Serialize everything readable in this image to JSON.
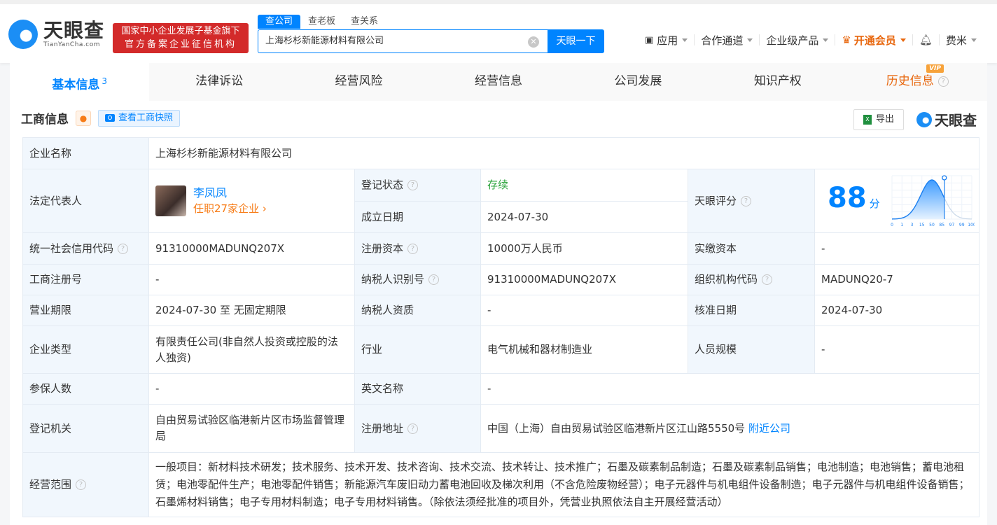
{
  "header": {
    "logo_cn": "天眼查",
    "logo_en": "TianYanCha.com",
    "badge_line1": "国家中小企业发展子基金旗下",
    "badge_line2": "官方备案企业征信机构",
    "search_tabs": [
      "查公司",
      "查老板",
      "查关系"
    ],
    "search_value": "上海杉杉新能源材料有限公司",
    "search_button": "天眼一下",
    "nav": [
      "应用",
      "合作通道",
      "企业级产品",
      "开通会员",
      "费米"
    ]
  },
  "tabs": [
    {
      "label": "基本信息",
      "count": "3"
    },
    {
      "label": "法律诉讼"
    },
    {
      "label": "经营风险"
    },
    {
      "label": "经营信息"
    },
    {
      "label": "公司发展"
    },
    {
      "label": "知识产权"
    },
    {
      "label": "历史信息",
      "badge": "VIP"
    }
  ],
  "section": {
    "title": "工商信息",
    "snapshot": "查看工商快照",
    "export": "导出",
    "brand": "天眼查"
  },
  "info": {
    "company_name_label": "企业名称",
    "company_name": "上海杉杉新能源材料有限公司",
    "legal_rep_label": "法定代表人",
    "legal_rep": "李凤凤",
    "legal_rep_companies": "任职27家企业",
    "status_label": "登记状态",
    "status": "存续",
    "founded_label": "成立日期",
    "founded": "2024-07-30",
    "score_label": "天眼评分",
    "score": "88",
    "score_unit": "分",
    "credit_code_label": "统一社会信用代码",
    "credit_code": "91310000MADUNQ207X",
    "reg_capital_label": "注册资本",
    "reg_capital": "10000万人民币",
    "paid_capital_label": "实缴资本",
    "paid_capital": "-",
    "reg_no_label": "工商注册号",
    "reg_no": "-",
    "taxpayer_id_label": "纳税人识别号",
    "taxpayer_id": "91310000MADUNQ207X",
    "org_code_label": "组织机构代码",
    "org_code": "MADUNQ20-7",
    "term_label": "营业期限",
    "term": "2024-07-30 至 无固定期限",
    "taxpayer_qual_label": "纳税人资质",
    "taxpayer_qual": "-",
    "approved_label": "核准日期",
    "approved": "2024-07-30",
    "type_label": "企业类型",
    "type": "有限责任公司(非自然人投资或控股的法人独资)",
    "industry_label": "行业",
    "industry": "电气机械和器材制造业",
    "staff_label": "人员规模",
    "staff": "-",
    "insured_label": "参保人数",
    "insured": "-",
    "english_label": "英文名称",
    "english": "-",
    "authority_label": "登记机关",
    "authority": "自由贸易试验区临港新片区市场监督管理局",
    "address_label": "注册地址",
    "address": "中国（上海）自由贸易试验区临港新片区江山路5550号",
    "nearby": "附近公司",
    "scope_label": "经营范围",
    "scope": "一般项目：新材料技术研发；技术服务、技术开发、技术咨询、技术交流、技术转让、技术推广；石墨及碳素制品制造；石墨及碳素制品销售；电池制造；电池销售；蓄电池租赁；电池零配件生产；电池零配件销售；新能源汽车废旧动力蓄电池回收及梯次利用（不含危险废物经营）；电子元器件与机电组件设备制造；电子元器件与机电组件设备销售；石墨烯材料销售；电子专用材料制造；电子专用材料销售。（除依法须经批准的项目外，凭营业执照依法自主开展经营活动）"
  },
  "chart_data": {
    "type": "area",
    "title": "",
    "x_ticks": [
      "0",
      "1",
      "3",
      "15",
      "50",
      "85",
      "97",
      "99",
      "100"
    ],
    "marker": "88",
    "xlabel": "",
    "ylabel": ""
  }
}
